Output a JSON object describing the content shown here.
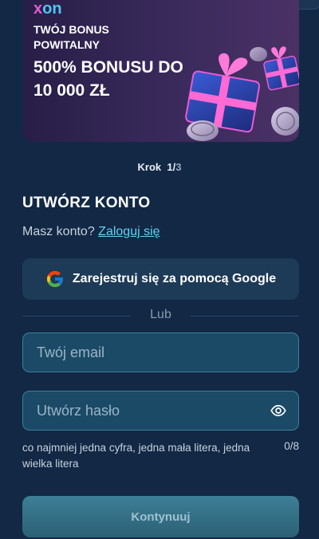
{
  "banner": {
    "brand_x": "x",
    "brand_on": "on",
    "subtitle": "Twój bonus powitalny",
    "headline": "500% BONUSU DO 10 000 ZŁ"
  },
  "step": {
    "label": "Krok",
    "current": "1/",
    "total": "3"
  },
  "form": {
    "title": "UTWÓRZ KONTO",
    "have_account": "Masz konto?",
    "login_link": "Zaloguj się",
    "google_label": "Zarejestruj się za pomocą Google",
    "or_label": "Lub",
    "email_placeholder": "Twój email",
    "password_placeholder": "Utwórz hasło",
    "password_hint": "co najmniej jedna cyfra, jedna mała litera, jedna wielka litera",
    "password_count": "0/8",
    "continue_label": "Kontynuuj"
  },
  "icons": {
    "google": "google-logo-icon",
    "eye": "eye-icon",
    "gifts": "gift-boxes-illustration"
  },
  "colors": {
    "background": "#122844",
    "accent_link": "#5fd3f5",
    "brand_pink": "#e35bd0",
    "brand_blue": "#4fc7f0",
    "button_disabled": "#2c6076"
  }
}
